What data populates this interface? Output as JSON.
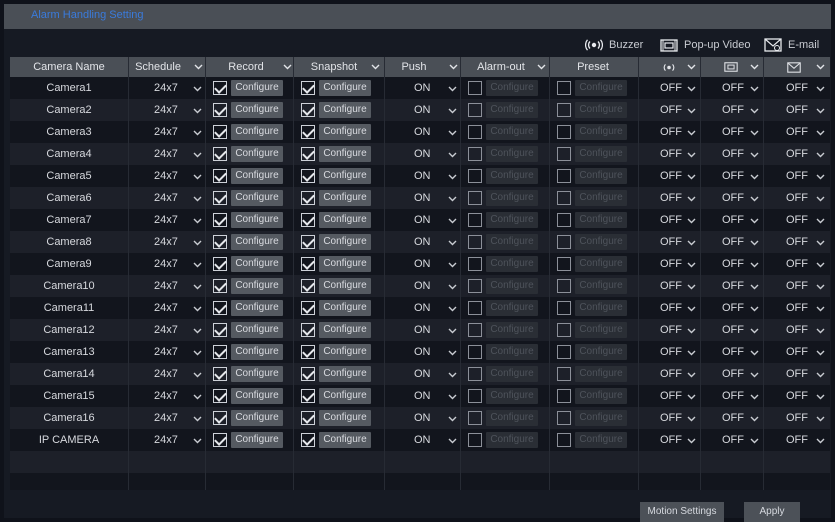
{
  "title": "Alarm Handling Setting",
  "legend": [
    {
      "icon": "buzzer-icon",
      "label": "Buzzer"
    },
    {
      "icon": "popup-video-icon",
      "label": "Pop-up Video"
    },
    {
      "icon": "email-icon",
      "label": "E-mail"
    }
  ],
  "columns": {
    "camera_name": "Camera Name",
    "schedule": "Schedule",
    "record": "Record",
    "snapshot": "Snapshot",
    "push": "Push",
    "alarm_out": "Alarm-out",
    "preset": "Preset"
  },
  "button_label": "Configure",
  "rows": [
    {
      "name": "Camera1",
      "schedule": "24x7",
      "record": true,
      "snapshot": true,
      "push": "ON",
      "alarm_out": false,
      "preset": false,
      "buzzer": "OFF",
      "popup": "OFF",
      "email": "OFF"
    },
    {
      "name": "Camera2",
      "schedule": "24x7",
      "record": true,
      "snapshot": true,
      "push": "ON",
      "alarm_out": false,
      "preset": false,
      "buzzer": "OFF",
      "popup": "OFF",
      "email": "OFF"
    },
    {
      "name": "Camera3",
      "schedule": "24x7",
      "record": true,
      "snapshot": true,
      "push": "ON",
      "alarm_out": false,
      "preset": false,
      "buzzer": "OFF",
      "popup": "OFF",
      "email": "OFF"
    },
    {
      "name": "Camera4",
      "schedule": "24x7",
      "record": true,
      "snapshot": true,
      "push": "ON",
      "alarm_out": false,
      "preset": false,
      "buzzer": "OFF",
      "popup": "OFF",
      "email": "OFF"
    },
    {
      "name": "Camera5",
      "schedule": "24x7",
      "record": true,
      "snapshot": true,
      "push": "ON",
      "alarm_out": false,
      "preset": false,
      "buzzer": "OFF",
      "popup": "OFF",
      "email": "OFF"
    },
    {
      "name": "Camera6",
      "schedule": "24x7",
      "record": true,
      "snapshot": true,
      "push": "ON",
      "alarm_out": false,
      "preset": false,
      "buzzer": "OFF",
      "popup": "OFF",
      "email": "OFF"
    },
    {
      "name": "Camera7",
      "schedule": "24x7",
      "record": true,
      "snapshot": true,
      "push": "ON",
      "alarm_out": false,
      "preset": false,
      "buzzer": "OFF",
      "popup": "OFF",
      "email": "OFF"
    },
    {
      "name": "Camera8",
      "schedule": "24x7",
      "record": true,
      "snapshot": true,
      "push": "ON",
      "alarm_out": false,
      "preset": false,
      "buzzer": "OFF",
      "popup": "OFF",
      "email": "OFF"
    },
    {
      "name": "Camera9",
      "schedule": "24x7",
      "record": true,
      "snapshot": true,
      "push": "ON",
      "alarm_out": false,
      "preset": false,
      "buzzer": "OFF",
      "popup": "OFF",
      "email": "OFF"
    },
    {
      "name": "Camera10",
      "schedule": "24x7",
      "record": true,
      "snapshot": true,
      "push": "ON",
      "alarm_out": false,
      "preset": false,
      "buzzer": "OFF",
      "popup": "OFF",
      "email": "OFF"
    },
    {
      "name": "Camera11",
      "schedule": "24x7",
      "record": true,
      "snapshot": true,
      "push": "ON",
      "alarm_out": false,
      "preset": false,
      "buzzer": "OFF",
      "popup": "OFF",
      "email": "OFF"
    },
    {
      "name": "Camera12",
      "schedule": "24x7",
      "record": true,
      "snapshot": true,
      "push": "ON",
      "alarm_out": false,
      "preset": false,
      "buzzer": "OFF",
      "popup": "OFF",
      "email": "OFF"
    },
    {
      "name": "Camera13",
      "schedule": "24x7",
      "record": true,
      "snapshot": true,
      "push": "ON",
      "alarm_out": false,
      "preset": false,
      "buzzer": "OFF",
      "popup": "OFF",
      "email": "OFF"
    },
    {
      "name": "Camera14",
      "schedule": "24x7",
      "record": true,
      "snapshot": true,
      "push": "ON",
      "alarm_out": false,
      "preset": false,
      "buzzer": "OFF",
      "popup": "OFF",
      "email": "OFF"
    },
    {
      "name": "Camera15",
      "schedule": "24x7",
      "record": true,
      "snapshot": true,
      "push": "ON",
      "alarm_out": false,
      "preset": false,
      "buzzer": "OFF",
      "popup": "OFF",
      "email": "OFF"
    },
    {
      "name": "Camera16",
      "schedule": "24x7",
      "record": true,
      "snapshot": true,
      "push": "ON",
      "alarm_out": false,
      "preset": false,
      "buzzer": "OFF",
      "popup": "OFF",
      "email": "OFF"
    },
    {
      "name": "IP CAMERA",
      "schedule": "24x7",
      "record": true,
      "snapshot": true,
      "push": "ON",
      "alarm_out": false,
      "preset": false,
      "buzzer": "OFF",
      "popup": "OFF",
      "email": "OFF"
    }
  ],
  "footer": {
    "motion_settings": "Motion Settings",
    "apply": "Apply"
  }
}
